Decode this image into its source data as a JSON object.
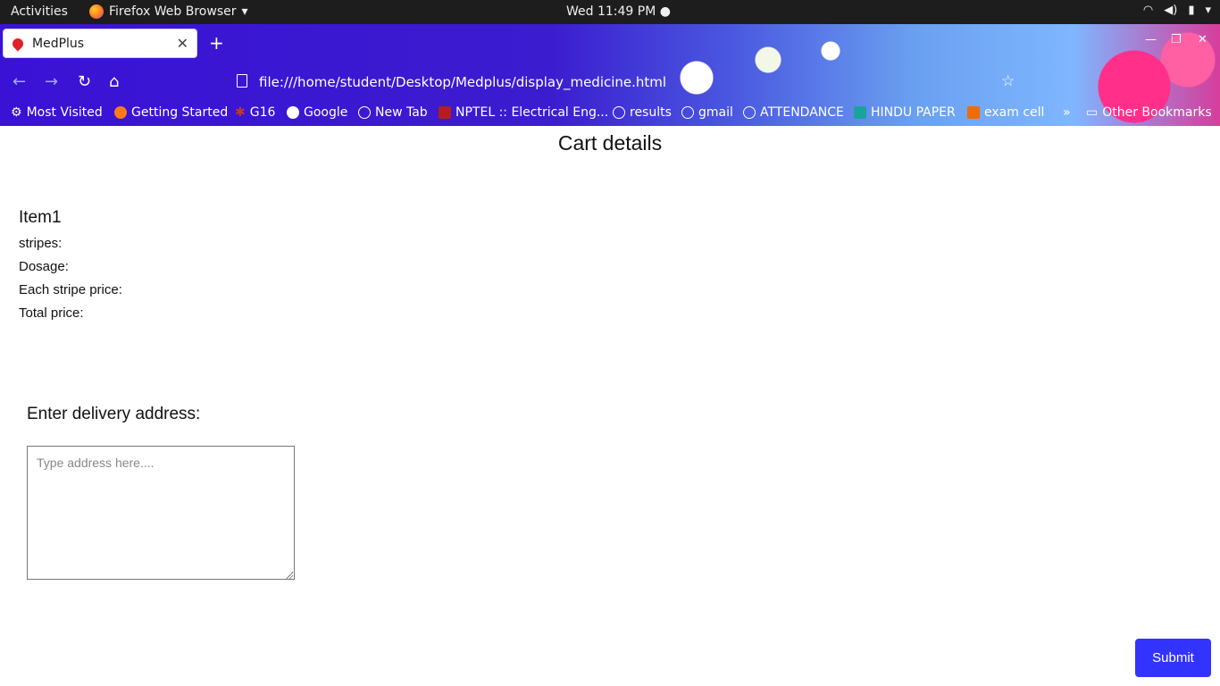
{
  "system_bar": {
    "activities": "Activities",
    "app_name": "Firefox Web Browser",
    "clock": "Wed 11:49 PM"
  },
  "browser": {
    "tab_title": "MedPlus",
    "url": "file:///home/student/Desktop/Medplus/display_medicine.html",
    "bookmarks": [
      {
        "label": "Most Visited",
        "icon": "gear-icon"
      },
      {
        "label": "Getting Started",
        "icon": "firefox-icon"
      },
      {
        "label": "G16",
        "icon": "bug-icon"
      },
      {
        "label": "Google",
        "icon": "google-icon"
      },
      {
        "label": "New Tab",
        "icon": "globe-icon"
      },
      {
        "label": "NPTEL :: Electrical Eng...",
        "icon": "nptel-icon"
      },
      {
        "label": "results",
        "icon": "globe-icon"
      },
      {
        "label": "gmail",
        "icon": "globe-icon"
      },
      {
        "label": "ATTENDANCE",
        "icon": "globe-icon"
      },
      {
        "label": "HINDU PAPER",
        "icon": "graduation-cap-icon"
      },
      {
        "label": "exam cell",
        "icon": "exam-icon"
      }
    ],
    "other_bookmarks": "Other Bookmarks"
  },
  "page": {
    "heading": "Cart details",
    "item": {
      "title": "Item1",
      "stripes_label": "stripes:",
      "dosage_label": "Dosage:",
      "stripe_price_label": "Each stripe price:",
      "total_price_label": "Total price:"
    },
    "address_label": "Enter delivery address:",
    "address_placeholder": "Type address here....",
    "address_value": "",
    "submit_label": "Submit"
  },
  "colors": {
    "submit_button": "#3333ff",
    "top_bar": "#1d1d1d"
  }
}
